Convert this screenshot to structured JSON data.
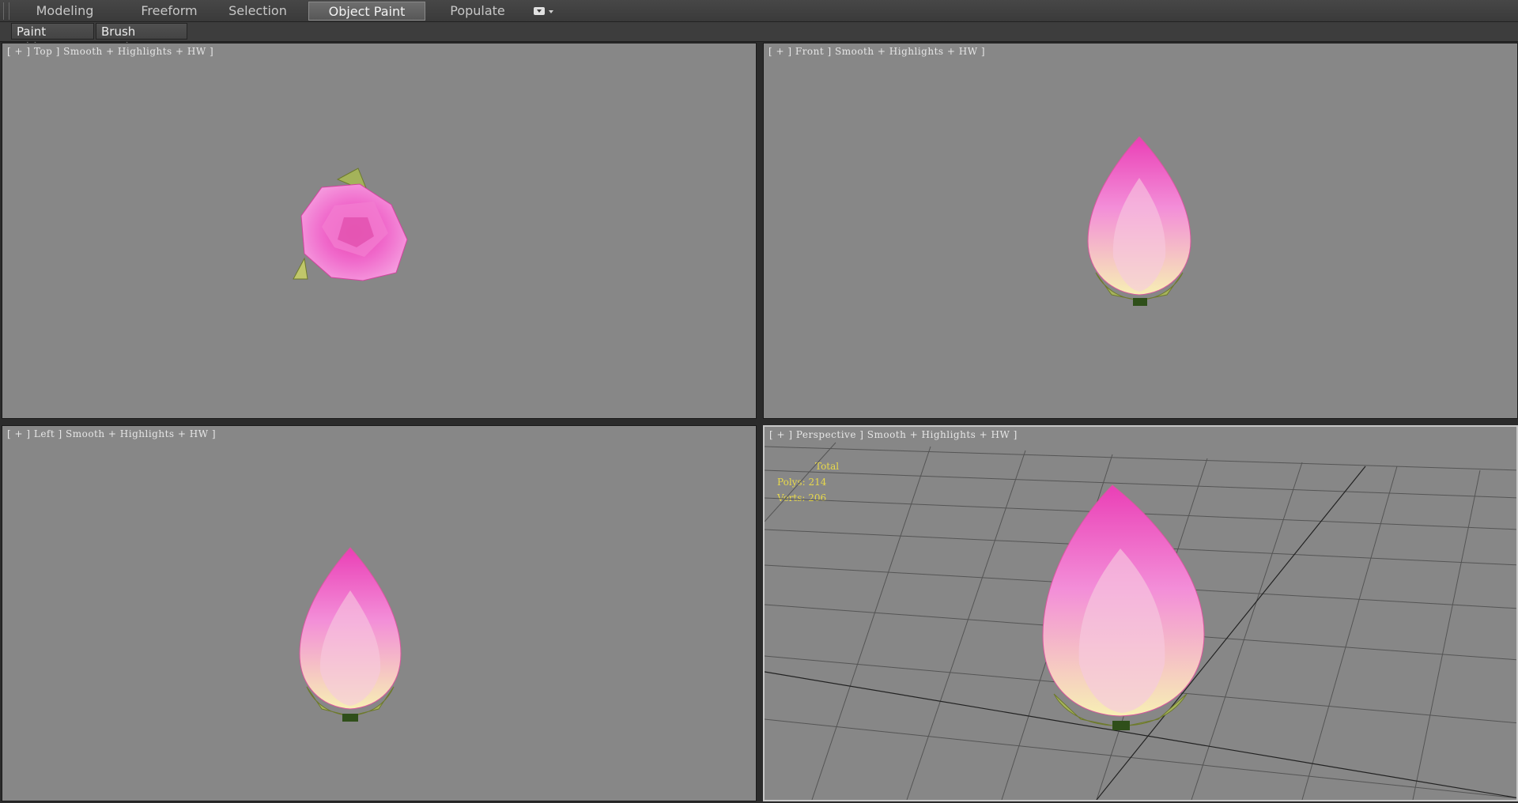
{
  "ribbon": {
    "tabs": [
      {
        "label": "Modeling"
      },
      {
        "label": "Freeform"
      },
      {
        "label": "Selection"
      },
      {
        "label": "Object Paint"
      },
      {
        "label": "Populate"
      }
    ],
    "active_tab": "Object Paint",
    "panel_buttons": [
      {
        "label": "Paint Objects"
      },
      {
        "label": "Brush Settings"
      }
    ]
  },
  "viewports": {
    "top": {
      "label": "[ + ] Top ] Smooth + Highlights + HW ]"
    },
    "front": {
      "label": "[ + ] Front ] Smooth + Highlights + HW ]"
    },
    "left": {
      "label": "[ + ] Left ] Smooth + Highlights + HW ]"
    },
    "perspective": {
      "label": "[ + ] Perspective ] Smooth + Highlights + HW ]",
      "stats": {
        "title": "Total",
        "polys": "Polys: 214",
        "verts": "Verts: 206"
      }
    }
  },
  "colors": {
    "viewport_bg": "#878787",
    "petal_pink": "#f05bc4",
    "petal_light": "#f7e7b8",
    "sepal_green": "#8aa24a",
    "stats_text": "#e8d94a"
  }
}
